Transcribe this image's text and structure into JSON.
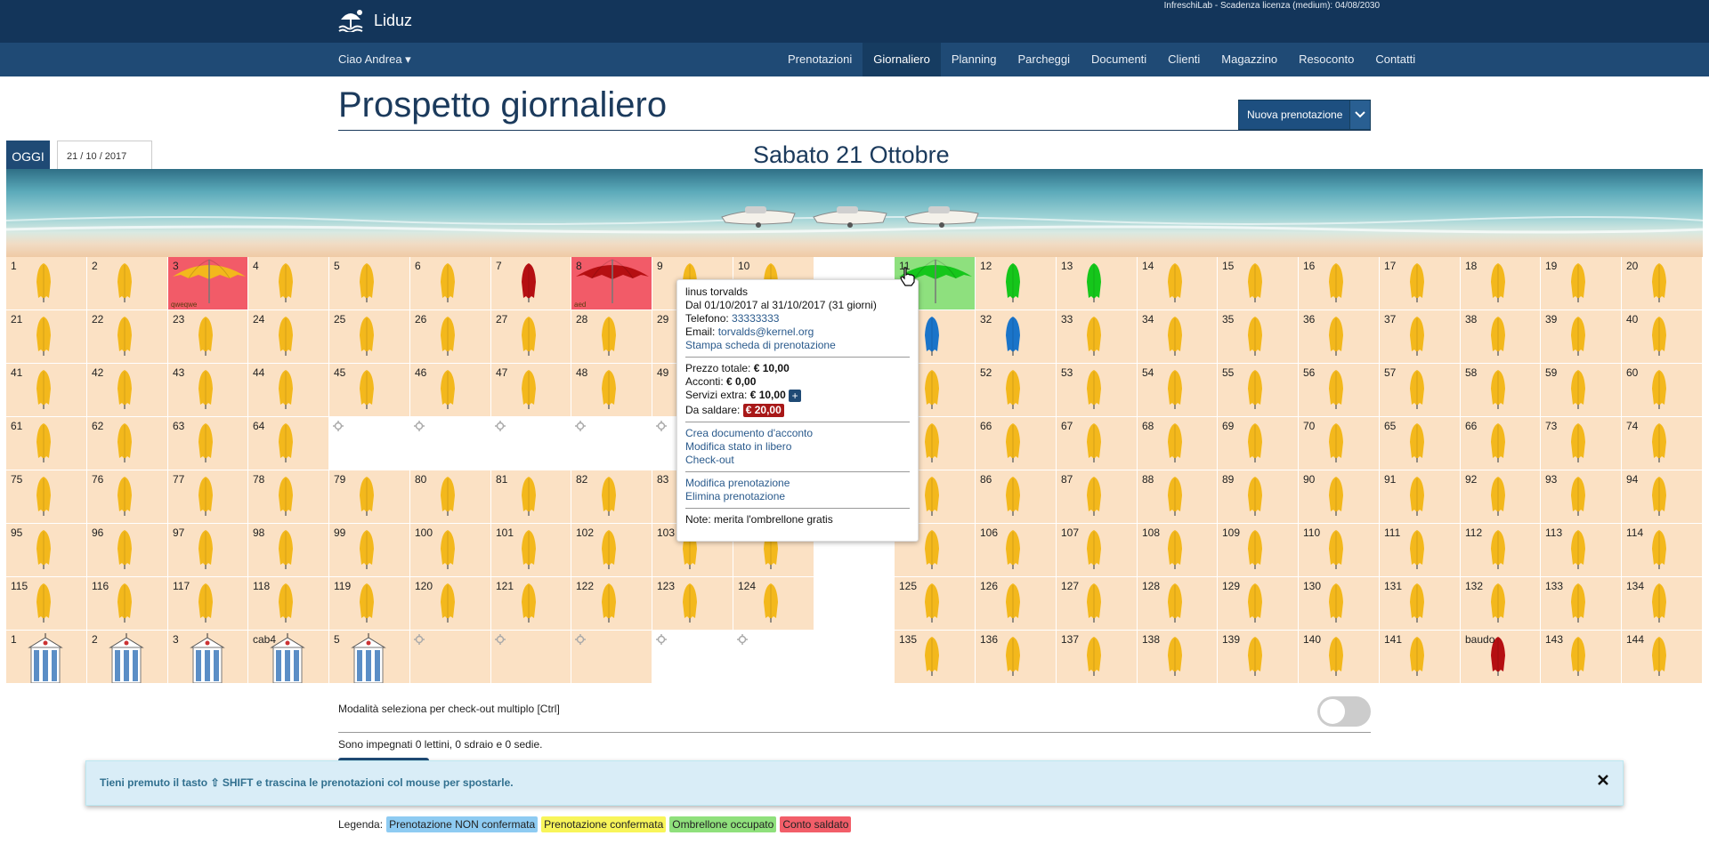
{
  "app": {
    "name": "Liduz",
    "license": "InfreschiLab - Scadenza licenza (medium): 04/08/2030"
  },
  "nav": {
    "user": "Ciao Andrea ▾",
    "items": [
      {
        "label": "Prenotazioni",
        "active": false
      },
      {
        "label": "Giornaliero",
        "active": true
      },
      {
        "label": "Planning",
        "active": false
      },
      {
        "label": "Parcheggi",
        "active": false
      },
      {
        "label": "Documenti",
        "active": false
      },
      {
        "label": "Clienti",
        "active": false
      },
      {
        "label": "Magazzino",
        "active": false
      },
      {
        "label": "Resoconto",
        "active": false
      },
      {
        "label": "Contatti",
        "active": false
      }
    ]
  },
  "page": {
    "title": "Prospetto giornaliero",
    "new_button": "Nuova prenotazione",
    "today_button": "OGGI",
    "date_value": "21 / 10 / 2017",
    "day_title": "Sabato 21 Ottobre"
  },
  "colors": {
    "yellow": "#f3b81c",
    "red": "#b50f12",
    "green": "#15c61b",
    "blue": "#1a74c9"
  },
  "grid": {
    "rows": [
      [
        {
          "n": "1"
        },
        {
          "n": "2"
        },
        {
          "n": "3",
          "s": "sel",
          "u": "big",
          "c": "yellow",
          "name": "qweqwe"
        },
        {
          "n": "4"
        },
        {
          "n": "5"
        },
        {
          "n": "6"
        },
        {
          "n": "7",
          "c": "red"
        },
        {
          "n": "8",
          "s": "sel",
          "u": "big",
          "c": "red",
          "name": "aed"
        },
        {
          "n": "9"
        },
        {
          "n": "10"
        },
        {
          "s": "blank",
          "u": "none"
        },
        {
          "n": "11",
          "s": "occ",
          "u": "big",
          "c": "green",
          "name": "lds"
        },
        {
          "n": "12",
          "c": "green"
        },
        {
          "n": "13",
          "c": "green"
        },
        {
          "n": "14"
        },
        {
          "n": "15"
        },
        {
          "n": "16"
        },
        {
          "n": "17"
        },
        {
          "n": "18"
        },
        {
          "n": "19"
        },
        {
          "n": "20"
        }
      ],
      [
        {
          "n": "21"
        },
        {
          "n": "22"
        },
        {
          "n": "23"
        },
        {
          "n": "24"
        },
        {
          "n": "25"
        },
        {
          "n": "26"
        },
        {
          "n": "27"
        },
        {
          "n": "28"
        },
        {
          "n": "29"
        },
        {
          "n": ""
        },
        {
          "s": "blank",
          "u": "none"
        },
        {
          "n": "",
          "c": "blue"
        },
        {
          "n": "32",
          "c": "blue"
        },
        {
          "n": "33"
        },
        {
          "n": "34"
        },
        {
          "n": "35"
        },
        {
          "n": "36"
        },
        {
          "n": "37"
        },
        {
          "n": "38"
        },
        {
          "n": "39"
        },
        {
          "n": "40"
        }
      ],
      [
        {
          "n": "41"
        },
        {
          "n": "42"
        },
        {
          "n": "43"
        },
        {
          "n": "44"
        },
        {
          "n": "45"
        },
        {
          "n": "46"
        },
        {
          "n": "47"
        },
        {
          "n": "48"
        },
        {
          "n": "49"
        },
        {
          "n": ""
        },
        {
          "s": "blank",
          "u": "none"
        },
        {
          "n": ""
        },
        {
          "n": "52"
        },
        {
          "n": "53"
        },
        {
          "n": "54"
        },
        {
          "n": "55"
        },
        {
          "n": "56"
        },
        {
          "n": "57"
        },
        {
          "n": "58"
        },
        {
          "n": "59"
        },
        {
          "n": "60"
        }
      ],
      [
        {
          "n": "61"
        },
        {
          "n": "62"
        },
        {
          "n": "63"
        },
        {
          "n": "64"
        },
        {
          "s": "blank",
          "u": "gear"
        },
        {
          "s": "blank",
          "u": "gear"
        },
        {
          "s": "blank",
          "u": "gear"
        },
        {
          "s": "blank",
          "u": "gear"
        },
        {
          "s": "blank",
          "u": "gear"
        },
        {
          "s": "blank",
          "u": "none"
        },
        {
          "s": "blank",
          "u": "none"
        },
        {
          "n": ""
        },
        {
          "n": "66"
        },
        {
          "n": "67"
        },
        {
          "n": "68"
        },
        {
          "n": "69"
        },
        {
          "n": "70"
        },
        {
          "n": "65"
        },
        {
          "n": "66"
        },
        {
          "n": "73"
        },
        {
          "n": "74"
        }
      ],
      [
        {
          "n": "75"
        },
        {
          "n": "76"
        },
        {
          "n": "77"
        },
        {
          "n": "78"
        },
        {
          "n": "79"
        },
        {
          "n": "80"
        },
        {
          "n": "81"
        },
        {
          "n": "82"
        },
        {
          "n": "83"
        },
        {
          "n": ""
        },
        {
          "s": "blank",
          "u": "none"
        },
        {
          "n": ""
        },
        {
          "n": "86"
        },
        {
          "n": "87"
        },
        {
          "n": "88"
        },
        {
          "n": "89"
        },
        {
          "n": "90"
        },
        {
          "n": "91"
        },
        {
          "n": "92"
        },
        {
          "n": "93"
        },
        {
          "n": "94"
        }
      ],
      [
        {
          "n": "95"
        },
        {
          "n": "96"
        },
        {
          "n": "97"
        },
        {
          "n": "98"
        },
        {
          "n": "99"
        },
        {
          "n": "100"
        },
        {
          "n": "101"
        },
        {
          "n": "102"
        },
        {
          "n": "103"
        },
        {
          "n": ""
        },
        {
          "s": "blank",
          "u": "none"
        },
        {
          "n": ""
        },
        {
          "n": "106"
        },
        {
          "n": "107"
        },
        {
          "n": "108"
        },
        {
          "n": "109"
        },
        {
          "n": "110"
        },
        {
          "n": "111"
        },
        {
          "n": "112"
        },
        {
          "n": "113"
        },
        {
          "n": "114"
        }
      ],
      [
        {
          "n": "115"
        },
        {
          "n": "116"
        },
        {
          "n": "117"
        },
        {
          "n": "118"
        },
        {
          "n": "119"
        },
        {
          "n": "120"
        },
        {
          "n": "121"
        },
        {
          "n": "122"
        },
        {
          "n": "123"
        },
        {
          "n": "124"
        },
        {
          "s": "blank",
          "u": "none"
        },
        {
          "n": "125"
        },
        {
          "n": "126"
        },
        {
          "n": "127"
        },
        {
          "n": "128"
        },
        {
          "n": "129"
        },
        {
          "n": "130"
        },
        {
          "n": "131"
        },
        {
          "n": "132"
        },
        {
          "n": "133"
        },
        {
          "n": "134"
        }
      ],
      [
        {
          "n": "1",
          "u": "cab"
        },
        {
          "n": "2",
          "u": "cab"
        },
        {
          "n": "3",
          "u": "cab"
        },
        {
          "n": "cab4",
          "u": "cab"
        },
        {
          "n": "5",
          "u": "cab"
        },
        {
          "u": "gear"
        },
        {
          "u": "gear"
        },
        {
          "u": "gear"
        },
        {
          "s": "blank",
          "u": "gear"
        },
        {
          "s": "blank",
          "u": "gear"
        },
        {
          "s": "blank",
          "u": "none"
        },
        {
          "n": "135"
        },
        {
          "n": "136"
        },
        {
          "n": "137"
        },
        {
          "n": "138"
        },
        {
          "n": "139"
        },
        {
          "n": "140"
        },
        {
          "n": "141"
        },
        {
          "n": "baudo",
          "c": "red"
        },
        {
          "n": "143"
        },
        {
          "n": "144"
        }
      ]
    ]
  },
  "popup": {
    "name": "linus torvalds",
    "period": "Dal 01/10/2017 al 31/10/2017 (31 giorni)",
    "phone_label": "Telefono:",
    "phone": "33333333",
    "email_label": "Email:",
    "email": "torvalds@kernel.org",
    "print_link": "Stampa scheda di prenotazione",
    "total_label": "Prezzo totale:",
    "total": "€ 10,00",
    "deposit_label": "Acconti:",
    "deposit": "€ 0,00",
    "extra_label": "Servizi extra:",
    "extra": "€ 10,00",
    "plus": "+",
    "due_label": "Da saldare:",
    "due": "€ 20,00",
    "create_doc": "Crea documento d'acconto",
    "set_free": "Modifica stato in libero",
    "checkout": "Check-out",
    "edit": "Modifica prenotazione",
    "delete": "Elimina prenotazione",
    "notes": "Note: merita l'ombrellone gratis"
  },
  "footer": {
    "multi_checkout": "Modalità seleziona per check-out multiplo [Ctrl]",
    "summary": "Sono impegnati 0 lettini, 0 sdraio e 0 sedie.",
    "alert": "Tieni premuto il tasto ⇧ SHIFT e trascina le prenotazioni col mouse per spostarle.",
    "legend_label": "Legenda:",
    "legend": [
      {
        "label": "Prenotazione NON confermata",
        "color": "#8ecbf2"
      },
      {
        "label": "Prenotazione confermata",
        "color": "#f8f55a"
      },
      {
        "label": "Ombrellone occupato",
        "color": "#8fe07c"
      },
      {
        "label": "Conto saldato",
        "color": "#f25e69"
      }
    ]
  }
}
